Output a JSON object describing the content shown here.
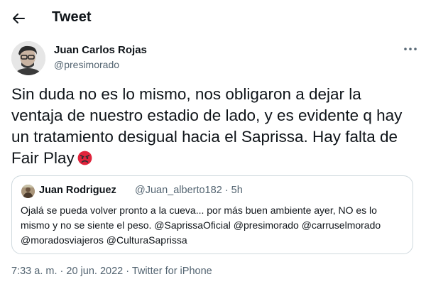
{
  "header": {
    "title": "Tweet",
    "back_icon": "arrow-left-icon"
  },
  "tweet": {
    "author_name": "Juan Carlos Rojas",
    "author_handle": "@presimorado",
    "more_icon": "more-icon",
    "text": "Sin duda no es lo mismo, nos obligaron a dejar la ventaja de nuestro estadio de lado, y es evidente q hay un tratamiento desigual hacia el Saprissa. Hay falta de Fair Play",
    "emoji": "angry-face-icon",
    "time": "7:33 a. m.",
    "date": "20 jun. 2022",
    "source": "Twitter for iPhone",
    "separator": "·"
  },
  "quoted": {
    "author_name": "Juan Rodriguez",
    "author_handle": "@Juan_alberto182",
    "separator": "·",
    "age": "5h",
    "text": "Ojalá se pueda volver pronto a la cueva... por más buen ambiente ayer, NO es lo mismo y no se siente el peso. @SaprissaOficial @presimorado @carruselmorado @moradosviajeros @CulturaSaprissa"
  },
  "colors": {
    "text": "#0f1419",
    "secondary": "#536471",
    "border": "#cfd9de",
    "emoji": "#e0243c"
  }
}
